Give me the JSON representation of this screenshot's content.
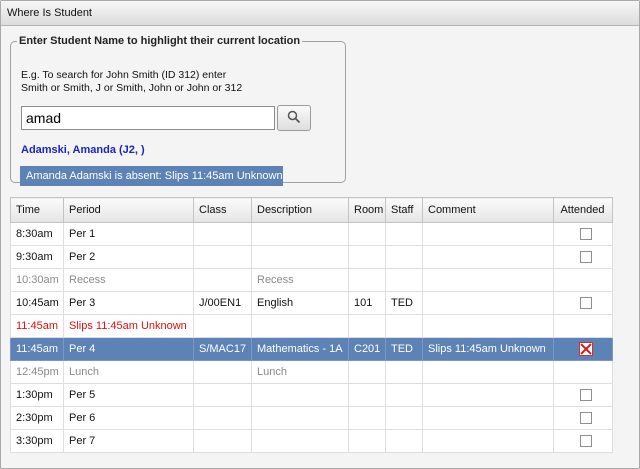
{
  "window": {
    "title": "Where Is Student"
  },
  "search": {
    "legend": "Enter Student Name to highlight their current location",
    "hint_line1": "E.g. To search for John Smith (ID 312) enter",
    "hint_line2": "Smith or Smith, J or Smith, John or John or 312",
    "value": "amad",
    "result_link": "Adamski, Amanda (J2, )",
    "absent_message": "Amanda Adamski is absent: Slips 11:45am Unknown"
  },
  "table": {
    "headers": [
      "Time",
      "Period",
      "Class",
      "Description",
      "Room",
      "Staff",
      "Comment",
      "Attended"
    ],
    "rows": [
      {
        "time": "8:30am",
        "period": "Per 1",
        "class": "",
        "description": "",
        "room": "",
        "staff": "",
        "comment": "",
        "attended": "unchecked",
        "style": "normal"
      },
      {
        "time": "9:30am",
        "period": "Per 2",
        "class": "",
        "description": "",
        "room": "",
        "staff": "",
        "comment": "",
        "attended": "unchecked",
        "style": "normal"
      },
      {
        "time": "10:30am",
        "period": "Recess",
        "class": "",
        "description": "Recess",
        "room": "",
        "staff": "",
        "comment": "",
        "attended": "none",
        "style": "muted"
      },
      {
        "time": "10:45am",
        "period": "Per 3",
        "class": "J/00EN1",
        "description": "English",
        "room": "101",
        "staff": "TED",
        "comment": "",
        "attended": "unchecked",
        "style": "normal"
      },
      {
        "time": "11:45am",
        "period": "Slips 11:45am Unknown",
        "class": "",
        "description": "",
        "room": "",
        "staff": "",
        "comment": "",
        "attended": "none",
        "style": "alert"
      },
      {
        "time": "11:45am",
        "period": "Per 4",
        "class": "S/MAC17",
        "description": "Mathematics - 1A",
        "room": "C201",
        "staff": "TED",
        "comment": "Slips 11:45am Unknown",
        "attended": "crossed",
        "style": "selected"
      },
      {
        "time": "12:45pm",
        "period": "Lunch",
        "class": "",
        "description": "Lunch",
        "room": "",
        "staff": "",
        "comment": "",
        "attended": "none",
        "style": "muted"
      },
      {
        "time": "1:30pm",
        "period": "Per 5",
        "class": "",
        "description": "",
        "room": "",
        "staff": "",
        "comment": "",
        "attended": "unchecked",
        "style": "normal"
      },
      {
        "time": "2:30pm",
        "period": "Per 6",
        "class": "",
        "description": "",
        "room": "",
        "staff": "",
        "comment": "",
        "attended": "unchecked",
        "style": "normal"
      },
      {
        "time": "3:30pm",
        "period": "Per 7",
        "class": "",
        "description": "",
        "room": "",
        "staff": "",
        "comment": "",
        "attended": "unchecked",
        "style": "normal"
      }
    ]
  },
  "icons": {
    "search_button": "search-icon"
  },
  "colors": {
    "selected_row": "#5d82b5",
    "alert_text": "#e01010",
    "link_text": "#1b24c4",
    "muted_text": "#8a8a8a"
  }
}
